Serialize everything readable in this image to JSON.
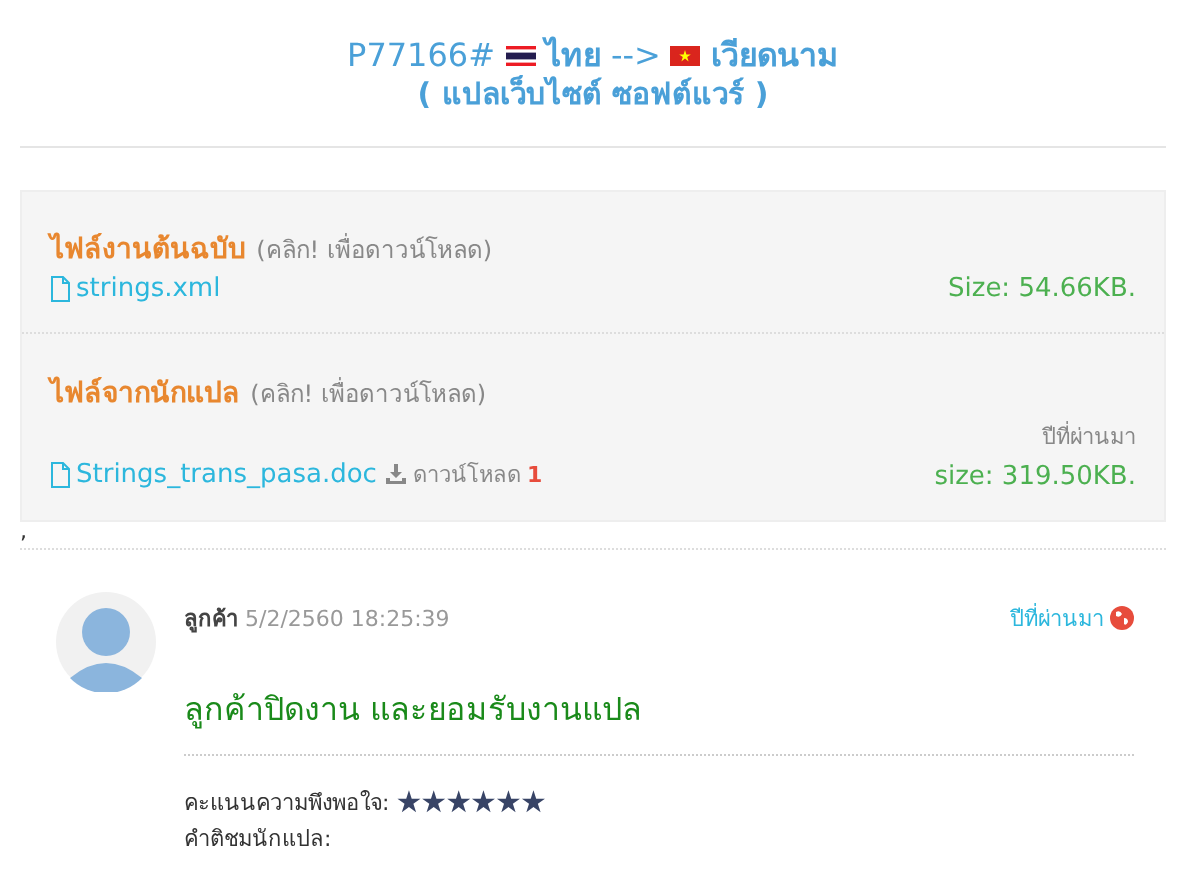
{
  "header": {
    "code": "P77166#",
    "source_language": "ไทย",
    "arrow": "-->",
    "target_language": "เวียดนาม",
    "subtitle": "( แปลเว็บไซต์ ซอฟต์แวร์ )"
  },
  "files": [
    {
      "title": "ไฟล์งานต้นฉบับ",
      "hint": "(คลิก! เพื่อดาวน์โหลด)",
      "name": "strings.xml",
      "size": "Size: 54.66KB."
    },
    {
      "title": "ไฟล์จากนักแปล",
      "hint": "(คลิก! เพื่อดาวน์โหลด)",
      "name": "Strings_trans_pasa.doc",
      "time": "ปีที่ผ่านมา",
      "size": "size: 319.50KB.",
      "download_label": "ดาวน์โหลด",
      "download_count": "1"
    }
  ],
  "separator_mark": ",",
  "comment": {
    "author": "ลูกค้า",
    "date": "5/2/2560 18:25:39",
    "time_ago": "ปีที่ผ่านมา",
    "message": "ลูกค้าปิดงาน และยอมรับงานแปล",
    "rating_label": "คะแนนความพึงพอใจ:",
    "stars": 6,
    "review_label": "คำติชมนักแปล:"
  }
}
